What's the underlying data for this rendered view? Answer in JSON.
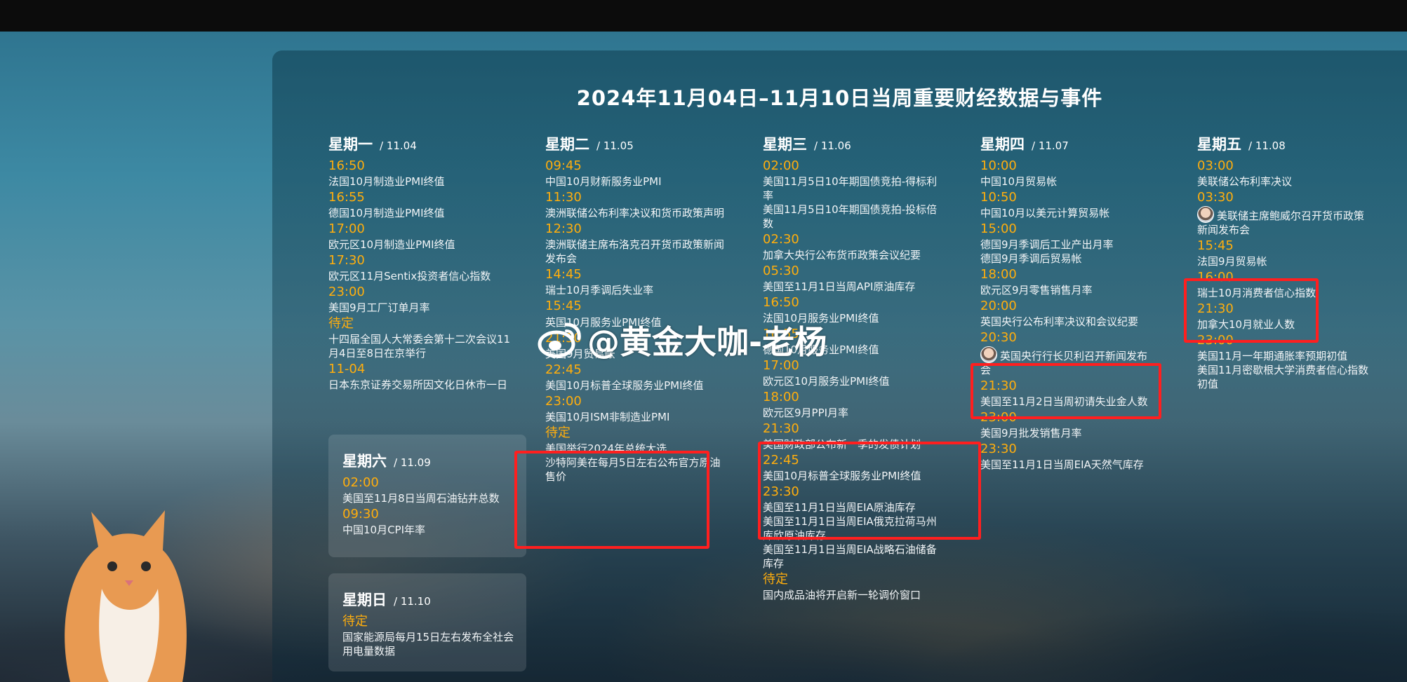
{
  "title": "2024年11月04日–11月10日当周重要财经数据与事件",
  "watermark": {
    "text": "@黄金大咖-老杨"
  },
  "days": [
    {
      "name": "星期一",
      "date": "/ 11.04",
      "events": [
        {
          "time": "16:50",
          "lines": [
            "法国10月制造业PMI终值"
          ]
        },
        {
          "time": "16:55",
          "lines": [
            "德国10月制造业PMI终值"
          ]
        },
        {
          "time": "17:00",
          "lines": [
            "欧元区10月制造业PMI终值"
          ]
        },
        {
          "time": "17:30",
          "lines": [
            "欧元区11月Sentix投资者信心指数"
          ]
        },
        {
          "time": "23:00",
          "lines": [
            "美国9月工厂订单月率"
          ]
        },
        {
          "time": "待定",
          "lines": [
            "十四届全国人大常委会第十二次会议11月4日至8日在京举行"
          ]
        },
        {
          "time": "11-04",
          "lines": [
            "日本东京证券交易所因文化日休市一日"
          ]
        }
      ]
    },
    {
      "name": "星期二",
      "date": "/ 11.05",
      "events": [
        {
          "time": "09:45",
          "lines": [
            "中国10月财新服务业PMI"
          ]
        },
        {
          "time": "11:30",
          "lines": [
            "澳洲联储公布利率决议和货币政策声明"
          ]
        },
        {
          "time": "12:30",
          "lines": [
            "澳洲联储主席布洛克召开货币政策新闻发布会"
          ]
        },
        {
          "time": "14:45",
          "lines": [
            "瑞士10月季调后失业率"
          ]
        },
        {
          "time": "15:45",
          "lines": [
            ""
          ]
        },
        {
          "time": "",
          "lines": [
            "英国10月服务业PMI终值"
          ]
        },
        {
          "time": "21:30",
          "lines": [
            "美国9月贸易帐"
          ]
        },
        {
          "time": "22:45",
          "lines": [
            "美国10月标普全球服务业PMI终值"
          ]
        },
        {
          "time": "23:00",
          "lines": [
            "美国10月ISM非制造业PMI"
          ]
        },
        {
          "time": "待定",
          "lines": [
            "美国举行2024年总统大选",
            "沙特阿美在每月5日左右公布官方原油售价"
          ]
        }
      ]
    },
    {
      "name": "星期三",
      "date": "/ 11.06",
      "events": [
        {
          "time": "02:00",
          "lines": [
            "美国11月5日10年期国债竞拍-得标利率",
            "美国11月5日10年期国债竞拍-投标倍数"
          ]
        },
        {
          "time": "02:30",
          "lines": [
            "加拿大央行公布货币政策会议纪要"
          ]
        },
        {
          "time": "05:30",
          "lines": [
            "美国至11月1日当周API原油库存"
          ]
        },
        {
          "time": "16:50",
          "lines": [
            "法国10月服务业PMI终值"
          ]
        },
        {
          "time": "16:55",
          "lines": [
            "德国10月服务业PMI终值"
          ]
        },
        {
          "time": "17:00",
          "lines": [
            "欧元区10月服务业PMI终值"
          ]
        },
        {
          "time": "18:00",
          "lines": [
            "欧元区9月PPI月率"
          ]
        },
        {
          "time": "21:30",
          "lines": [
            "美国财政部公布新一季的发债计划"
          ]
        },
        {
          "time": "22:45",
          "lines": [
            "美国10月标普全球服务业PMI终值"
          ]
        },
        {
          "time": "23:30",
          "lines": [
            "美国至11月1日当周EIA原油库存",
            "美国至11月1日当周EIA俄克拉荷马州库欣原油库存",
            "美国至11月1日当周EIA战略石油储备库存"
          ]
        },
        {
          "time": "待定",
          "lines": [
            "国内成品油将开启新一轮调价窗口"
          ]
        }
      ]
    },
    {
      "name": "星期四",
      "date": "/ 11.07",
      "events": [
        {
          "time": "10:00",
          "lines": [
            "中国10月贸易帐"
          ]
        },
        {
          "time": "10:50",
          "lines": [
            "中国10月以美元计算贸易帐"
          ]
        },
        {
          "time": "15:00",
          "lines": [
            "德国9月季调后工业产出月率",
            "德国9月季调后贸易帐"
          ]
        },
        {
          "time": "18:00",
          "lines": [
            "欧元区9月零售销售月率"
          ]
        },
        {
          "time": "20:00",
          "lines": [
            "英国央行公布利率决议和会议纪要"
          ]
        },
        {
          "time": "20:30",
          "lines": [
            "英国央行行长贝利召开新闻发布会"
          ]
        },
        {
          "time": "21:30",
          "lines": [
            "美国至11月2日当周初请失业金人数"
          ]
        },
        {
          "time": "23:00",
          "lines": [
            "美国9月批发销售月率"
          ]
        },
        {
          "time": "23:30",
          "lines": [
            "美国至11月1日当周EIA天然气库存"
          ]
        }
      ]
    },
    {
      "name": "星期五",
      "date": "/ 11.08",
      "events": [
        {
          "time": "03:00",
          "lines": [
            "美联储公布利率决议"
          ]
        },
        {
          "time": "03:30",
          "lines": [
            "美联储主席鲍威尔召开货币政策新闻发布会"
          ]
        },
        {
          "time": "15:45",
          "lines": [
            "法国9月贸易帐"
          ]
        },
        {
          "time": "16:00",
          "lines": [
            "瑞士10月消费者信心指数"
          ]
        },
        {
          "time": "21:30",
          "lines": [
            "加拿大10月就业人数"
          ]
        },
        {
          "time": "23:00",
          "lines": [
            "美国11月一年期通胀率预期初值",
            "美国11月密歇根大学消费者信心指数初值"
          ]
        }
      ]
    },
    {
      "name": "星期六",
      "date": "/ 11.09",
      "events": [
        {
          "time": "02:00",
          "lines": [
            "美国至11月8日当周石油钻井总数"
          ]
        },
        {
          "time": "09:30",
          "lines": [
            "中国10月CPI年率"
          ]
        }
      ]
    },
    {
      "name": "星期日",
      "date": "/ 11.10",
      "events": [
        {
          "time": "待定",
          "lines": [
            "国家能源局每月15日左右发布全社会用电量数据"
          ]
        }
      ]
    }
  ]
}
